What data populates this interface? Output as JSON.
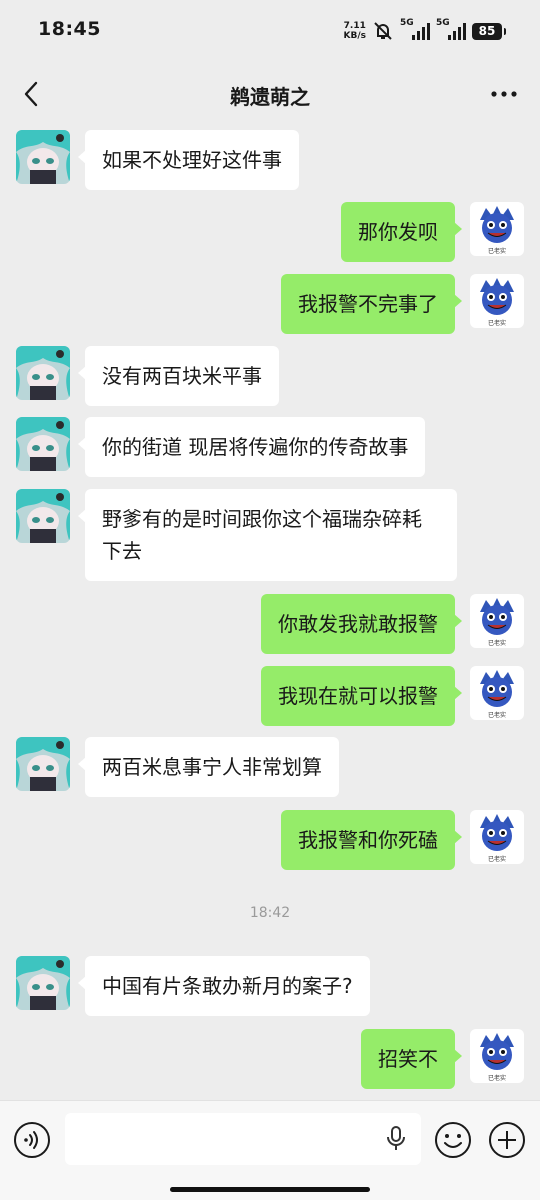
{
  "status_bar": {
    "time": "18:45",
    "net_speed_value": "7.11",
    "net_speed_unit": "KB/s",
    "signal1_label": "5G",
    "signal2_label": "5G",
    "battery": "85"
  },
  "header": {
    "title": "鹈遗萌之",
    "back_icon": "chevron-left-icon",
    "more_icon": "more-dots-icon"
  },
  "messages": [
    {
      "side": "in",
      "text": "如果不处理好这件事"
    },
    {
      "side": "out",
      "text": "那你发呗"
    },
    {
      "side": "out",
      "text": "我报警不完事了"
    },
    {
      "side": "in",
      "text": "没有两百块米平事"
    },
    {
      "side": "in",
      "text": "你的街道 现居将传遍你的传奇故事"
    },
    {
      "side": "in",
      "text": "野爹有的是时间跟你这个福瑞杂碎耗下去"
    },
    {
      "side": "out",
      "text": "你敢发我就敢报警"
    },
    {
      "side": "out",
      "text": "我现在就可以报警"
    },
    {
      "side": "in",
      "text": "两百米息事宁人非常划算"
    },
    {
      "side": "out",
      "text": "我报警和你死磕"
    },
    {
      "side": "in",
      "text": "中国有片条敢办新月的案子?"
    },
    {
      "side": "out",
      "text": "招笑不"
    }
  ],
  "time_separator": "18:42",
  "avatar_caption": "已老实",
  "input_bar": {
    "voice_icon": "voice-icon",
    "mic_icon": "microphone-icon",
    "emoji_icon": "emoji-icon",
    "plus_icon": "plus-icon",
    "input_value": ""
  },
  "colors": {
    "background": "#ededed",
    "outgoing_bubble": "#95ec69",
    "incoming_bubble": "#ffffff"
  }
}
